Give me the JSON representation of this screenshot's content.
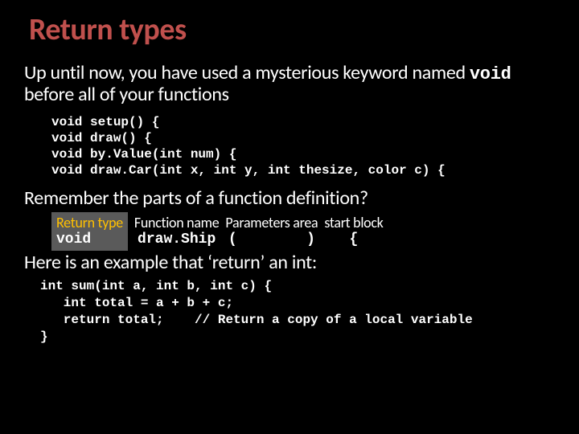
{
  "title": "Return types",
  "p1_a": "Up until now, you have used a mysterious keyword named ",
  "p1_kw": "void",
  "p1_b": " before all of your functions",
  "ex1": {
    "l1": "void setup() {",
    "l2": "void draw() {",
    "l3": "void by.Value(int num) {",
    "l4": "void draw.Car(int x, int y, int thesize, color c) {"
  },
  "p2": "Remember the parts of a function definition?",
  "def": {
    "rt_label": "Return type",
    "rt_code": "void",
    "fn_label": "Function name",
    "fn_code": "draw.Ship",
    "pa_label": "Parameters area",
    "pa_open": "(",
    "pa_close": ")",
    "sb_label": "start block",
    "sb_code": "{"
  },
  "p3": "Here is an example that ‘return’ an int:",
  "ex2": {
    "l1": "int sum(int a, int b, int c) {",
    "l2": "   int total = a + b + c;",
    "l3": "   return total;    // Return a copy of a local variable",
    "l4": "}"
  }
}
